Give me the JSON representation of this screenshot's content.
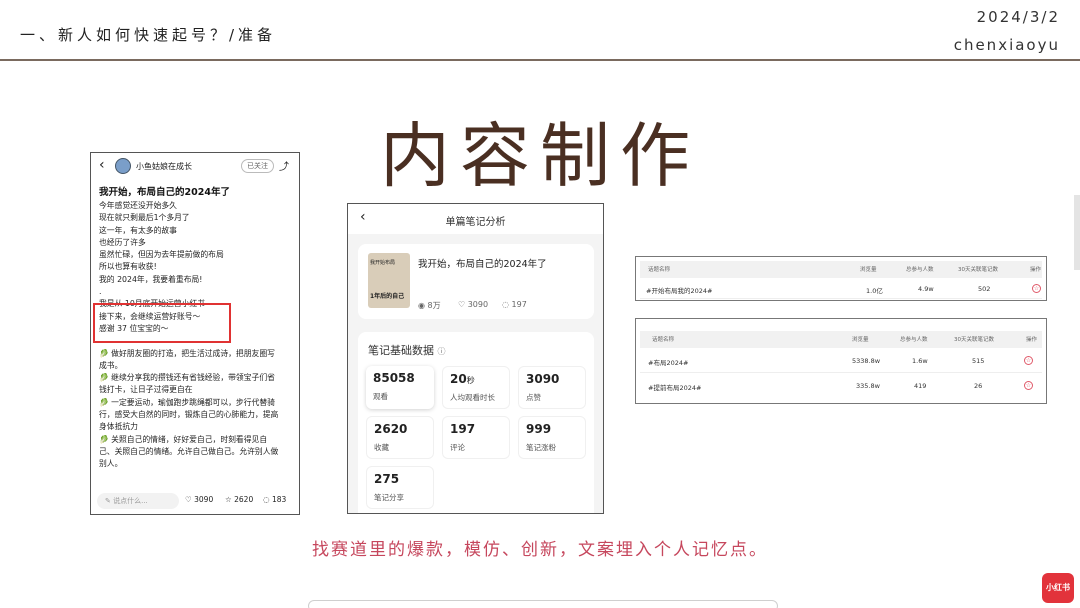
{
  "header": {
    "title": "一、新人如何快速起号？/准备",
    "date": "2024/3/2",
    "author": "chenxiaoyu"
  },
  "main_title": "内容制作",
  "left_phone": {
    "back_icon": "chevron-left-icon",
    "author_name": "小鱼姑娘在成长",
    "follow_label": "已关注",
    "share_icon": "share-icon",
    "post_title": "我开始，布局自己的2024年了",
    "lines": [
      "今年感觉还没开始多久",
      "现在就只剩最后1个多月了",
      "这一年，有太多的故事",
      "也经历了许多",
      "虽然忙碌，但因为去年提前做的布局",
      "所以也算有收获!",
      "我的 2024年，我要着重布局!",
      ".",
      "我是从 10月底开始运营小红书",
      "接下来，会继续运营好账号～",
      "感谢 37 位宝宝的～",
      ".",
      "🥬 做好朋友圈的打造，把生活过成诗，把朋友圈写",
      "成书。",
      "🥬 继续分享我的攒钱还有省钱经验，带领宝子们省",
      "钱打卡，让日子过得更自在",
      "🥬 一定要运动，瑜伽跑步跳绳都可以，步行代替骑",
      "行，感受大自然的同时，锻炼自己的心肺能力，提高",
      "身体抵抗力",
      "🥬 关照自己的情绪，好好爱自己，时刻看得见自",
      "己、关照自己的情绪。允许自己做自己。允许别人做",
      "别人。"
    ],
    "comment_placeholder": "说点什么...",
    "likes": "3090",
    "collects": "2620",
    "comments": "183"
  },
  "mid_phone": {
    "title": "单篇笔记分析",
    "post_title": "我开始，布局自己的2024年了",
    "thumb_top": "我开始布局",
    "thumb_bottom": "1年后的自己",
    "views": "8万",
    "likes": "3090",
    "comments": "197",
    "section_title": "笔记基础数据",
    "cells": [
      {
        "value": "85058",
        "unit": "",
        "label": "观看"
      },
      {
        "value": "20",
        "unit": "秒",
        "label": "人均观看时长"
      },
      {
        "value": "3090",
        "unit": "",
        "label": "点赞"
      },
      {
        "value": "2620",
        "unit": "",
        "label": "收藏"
      },
      {
        "value": "197",
        "unit": "",
        "label": "评论"
      },
      {
        "value": "999",
        "unit": "",
        "label": "笔记涨粉"
      },
      {
        "value": "275",
        "unit": "",
        "label": "笔记分享"
      }
    ]
  },
  "table1": {
    "headers": [
      "话题名称",
      "浏览量",
      "总参与人数",
      "30天关联笔记数",
      "操作"
    ],
    "rows": [
      {
        "name": "#开始布局我的2024#",
        "views": "1.0亿",
        "participants": "4.9w",
        "notes": "502"
      }
    ]
  },
  "table2": {
    "headers": [
      "话题名称",
      "浏览量",
      "总参与人数",
      "30天关联笔记数",
      "操作"
    ],
    "rows": [
      {
        "name": "#布局2024#",
        "views": "5338.8w",
        "participants": "1.6w",
        "notes": "515"
      },
      {
        "name": "#提前布局2024#",
        "views": "335.8w",
        "participants": "419",
        "notes": "26"
      }
    ]
  },
  "caption": "找赛道里的爆款，模仿、创新，文案埋入个人记忆点。",
  "brand_logo": "小红书"
}
